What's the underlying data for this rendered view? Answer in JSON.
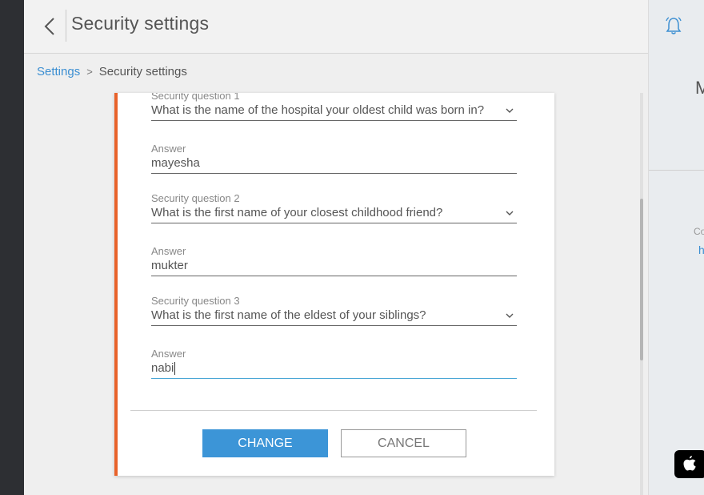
{
  "header": {
    "title": "Security settings"
  },
  "breadcrumb": {
    "parent": "Settings",
    "current": "Security settings"
  },
  "form": {
    "q1": {
      "label": "Security question 1",
      "value": "What is the name of the hospital your oldest child was born in?"
    },
    "a1": {
      "label": "Answer",
      "value": "mayesha"
    },
    "q2": {
      "label": "Security question 2",
      "value": "What is the first name of your closest childhood friend?"
    },
    "a2": {
      "label": "Answer",
      "value": "mukter"
    },
    "q3": {
      "label": "Security question 3",
      "value": "What is the first name of the eldest of your siblings?"
    },
    "a3": {
      "label": "Answer",
      "value": "nabi"
    }
  },
  "actions": {
    "change": "CHANGE",
    "cancel": "CANCEL"
  },
  "right_panel": {
    "letter": "M",
    "co": "Co",
    "h": "h"
  },
  "colors": {
    "accent": "#e8622a",
    "primary": "#3c95d7",
    "link": "#3c8fd2"
  },
  "icons": {
    "back": "chevron-left-icon",
    "dropdown": "chevron-down-icon",
    "notifications": "bell-icon",
    "store": "apple-icon"
  }
}
